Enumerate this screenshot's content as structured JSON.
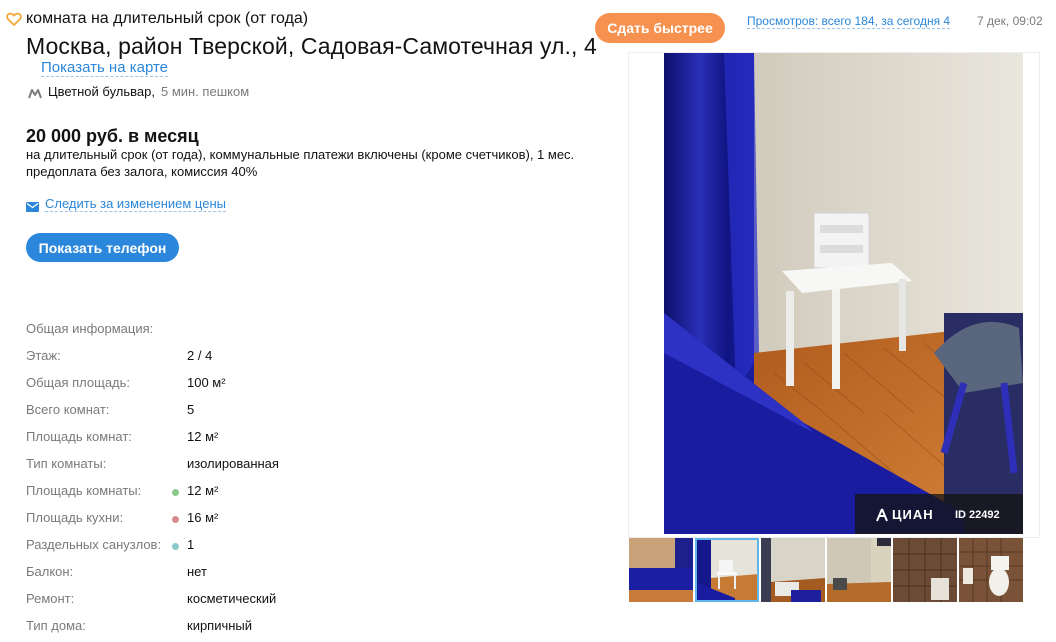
{
  "header": {
    "offer_type": "комната на длительный срок (от года)",
    "address": "Москва, район Тверской, Садовая-Самотечная ул., 4",
    "map_link": "Показать на карте",
    "metro_station": "Цветной бульвар,",
    "metro_time": "5 мин. пешком",
    "boost_button": "Сдать быстрее",
    "views": "Просмотров: всего 184, за сегодня 4",
    "date": "7 дек, 09:02"
  },
  "price": {
    "amount": "20 000 руб. в месяц",
    "description": "на длительный срок (от года), коммунальные платежи включены (кроме счетчиков), 1 мес. предоплата без залога, комиссия 40%",
    "watch_link": "Следить за изменением цены",
    "phone_button": "Показать телефон"
  },
  "specs": {
    "heading": "Общая информация:",
    "rows": [
      {
        "label": "Этаж:",
        "value": "2 / 4",
        "dot": ""
      },
      {
        "label": "Общая площадь:",
        "value": "100 м²",
        "dot": ""
      },
      {
        "label": "Всего комнат:",
        "value": "5",
        "dot": ""
      },
      {
        "label": "Площадь комнат:",
        "value": "12 м²",
        "dot": ""
      },
      {
        "label": "Тип комнаты:",
        "value": "изолированная",
        "dot": ""
      },
      {
        "label": "Площадь комнаты:",
        "value": "12 м²",
        "dot": "#8cc98c"
      },
      {
        "label": "Площадь кухни:",
        "value": "16 м²",
        "dot": "#d98a8a"
      },
      {
        "label": "Раздельных санузлов:",
        "value": "1",
        "dot": "#8cc9c9"
      },
      {
        "label": "Балкон:",
        "value": "нет",
        "dot": ""
      },
      {
        "label": "Ремонт:",
        "value": "косметический",
        "dot": ""
      },
      {
        "label": "Тип дома:",
        "value": "кирпичный",
        "dot": ""
      }
    ]
  },
  "gallery": {
    "watermark_logo": "ЦИАН",
    "watermark_id": "ID 22492",
    "thumbnails": [
      {
        "name": "thumb-1",
        "active": false
      },
      {
        "name": "thumb-2",
        "active": true
      },
      {
        "name": "thumb-3",
        "active": false
      },
      {
        "name": "thumb-4",
        "active": false
      },
      {
        "name": "thumb-5",
        "active": false
      },
      {
        "name": "thumb-6",
        "active": false
      }
    ]
  },
  "colors": {
    "link": "#2b87db",
    "primary_button": "#2b87db",
    "boost_button": "#f7914f",
    "favorite_icon": "#f2a93b",
    "metro_icon": "#8a8a8a"
  },
  "icons": {
    "favorite": "heart-outline-icon",
    "metro": "metro-icon",
    "mail": "mail-icon"
  }
}
